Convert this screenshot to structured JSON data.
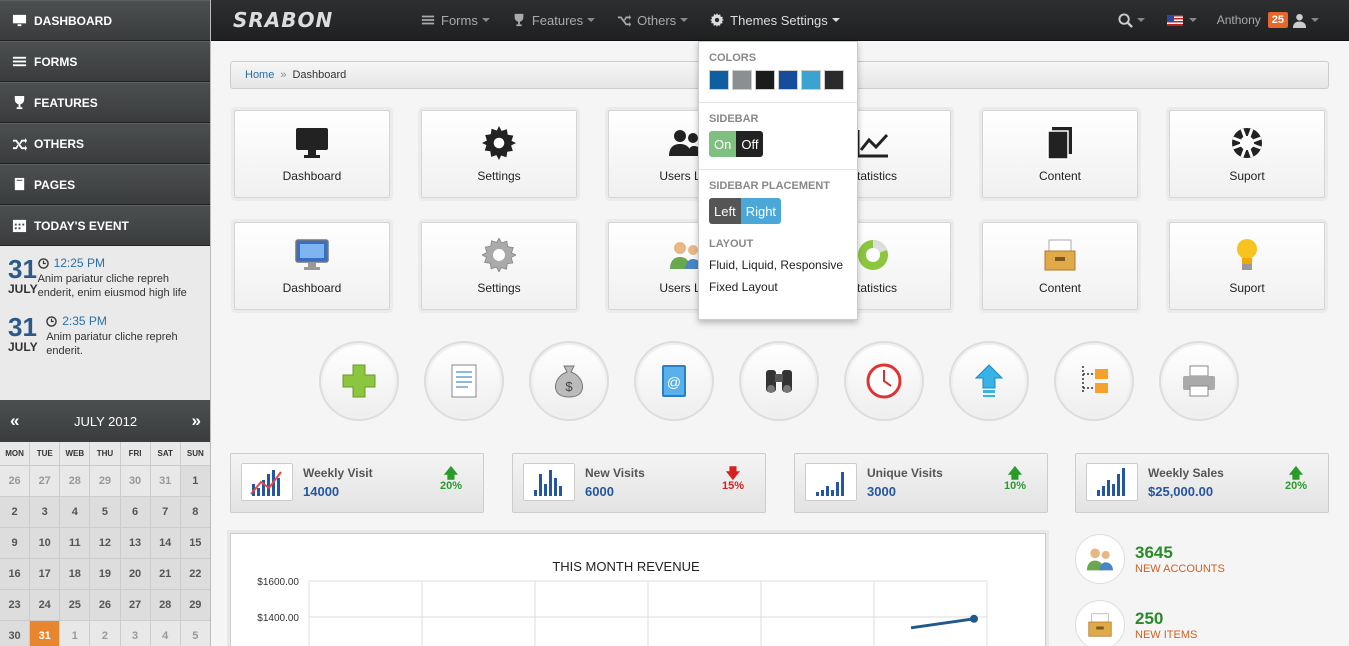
{
  "sidebar": {
    "menu": [
      {
        "label": "DASHBOARD",
        "icon": "monitor-icon"
      },
      {
        "label": "FORMS",
        "icon": "list-icon"
      },
      {
        "label": "FEATURES",
        "icon": "trophy-icon"
      },
      {
        "label": "OTHERS",
        "icon": "shuffle-icon"
      },
      {
        "label": "PAGES",
        "icon": "pages-icon"
      },
      {
        "label": "TODAY'S EVENT",
        "icon": "calendar-icon"
      }
    ],
    "events": [
      {
        "day": "31",
        "month": "JULY",
        "time": "12:25 PM",
        "desc": "Anim pariatur cliche repreh enderit, enim eiusmod high life"
      },
      {
        "day": "31",
        "month": "JULY",
        "time": "2:35 PM",
        "desc": "Anim pariatur cliche repreh enderit."
      }
    ],
    "calendar": {
      "prev": "«",
      "next": "»",
      "title": "JULY 2012",
      "weekdays": [
        "MON",
        "TUE",
        "WEB",
        "THU",
        "FRI",
        "SAT",
        "SUN"
      ],
      "weeks": [
        [
          "26",
          "27",
          "28",
          "29",
          "30",
          "31",
          "1"
        ],
        [
          "2",
          "3",
          "4",
          "5",
          "6",
          "7",
          "8"
        ],
        [
          "9",
          "10",
          "11",
          "12",
          "13",
          "14",
          "15"
        ],
        [
          "16",
          "17",
          "18",
          "19",
          "20",
          "21",
          "22"
        ],
        [
          "23",
          "24",
          "25",
          "26",
          "27",
          "28",
          "29"
        ],
        [
          "30",
          "31",
          "1",
          "2",
          "3",
          "4",
          "5"
        ]
      ],
      "today": "31"
    }
  },
  "topbar": {
    "logo": "SRABON",
    "nav": [
      {
        "label": "Forms",
        "icon": "list-icon"
      },
      {
        "label": "Features",
        "icon": "trophy-icon"
      },
      {
        "label": "Others",
        "icon": "shuffle-icon"
      },
      {
        "label": "Themes Settings",
        "icon": "gear-icon"
      }
    ],
    "user": "Anthony",
    "badge": "25"
  },
  "breadcrumb": {
    "home": "Home",
    "sep": "»",
    "current": "Dashboard"
  },
  "tiles_row1": [
    "Dashboard",
    "Settings",
    "Users List",
    "Statistics",
    "Content",
    "Suport"
  ],
  "tiles_row2": [
    "Dashboard",
    "Settings",
    "Users List",
    "Statistics",
    "Content",
    "Suport"
  ],
  "circle_icons": [
    "plus-icon",
    "document-icon",
    "money-bag-icon",
    "address-book-icon",
    "binoculars-icon",
    "clock-icon",
    "upload-arrow-icon",
    "folder-tree-icon",
    "printer-icon"
  ],
  "stats": [
    {
      "title": "Weekly Visit",
      "value": "14000",
      "pct": "20%",
      "dir": "up"
    },
    {
      "title": "New Visits",
      "value": "6000",
      "pct": "15%",
      "dir": "down"
    },
    {
      "title": "Unique Visits",
      "value": "3000",
      "pct": "10%",
      "dir": "up"
    },
    {
      "title": "Weekly Sales",
      "value": "$25,000.00",
      "pct": "20%",
      "dir": "up"
    }
  ],
  "chart_data": {
    "type": "line",
    "title": "THIS MONTH REVENUE",
    "y_ticks": [
      "$1600.00",
      "$1400.00"
    ],
    "ylim": [
      1300,
      1600
    ],
    "series": [
      {
        "values": [
          1340,
          1390
        ]
      }
    ]
  },
  "right_stats": [
    {
      "num": "3645",
      "label": "NEW ACCOUNTS"
    },
    {
      "num": "250",
      "label": "NEW ITEMS"
    }
  ],
  "theme_dropdown": {
    "colors_label": "COLORS",
    "colors": [
      "#0f5fa0",
      "#8a8f93",
      "#1b1b1b",
      "#154d9a",
      "#3ba3d0",
      "#2b2b2b"
    ],
    "sidebar_label": "SIDEBAR",
    "on": "On",
    "off": "Off",
    "placement_label": "SIDEBAR PLACEMENT",
    "left": "Left",
    "right": "Right",
    "layout_label": "LAYOUT",
    "layout_fluid": "Fluid, Liquid, Responsive",
    "layout_fixed": "Fixed Layout"
  }
}
